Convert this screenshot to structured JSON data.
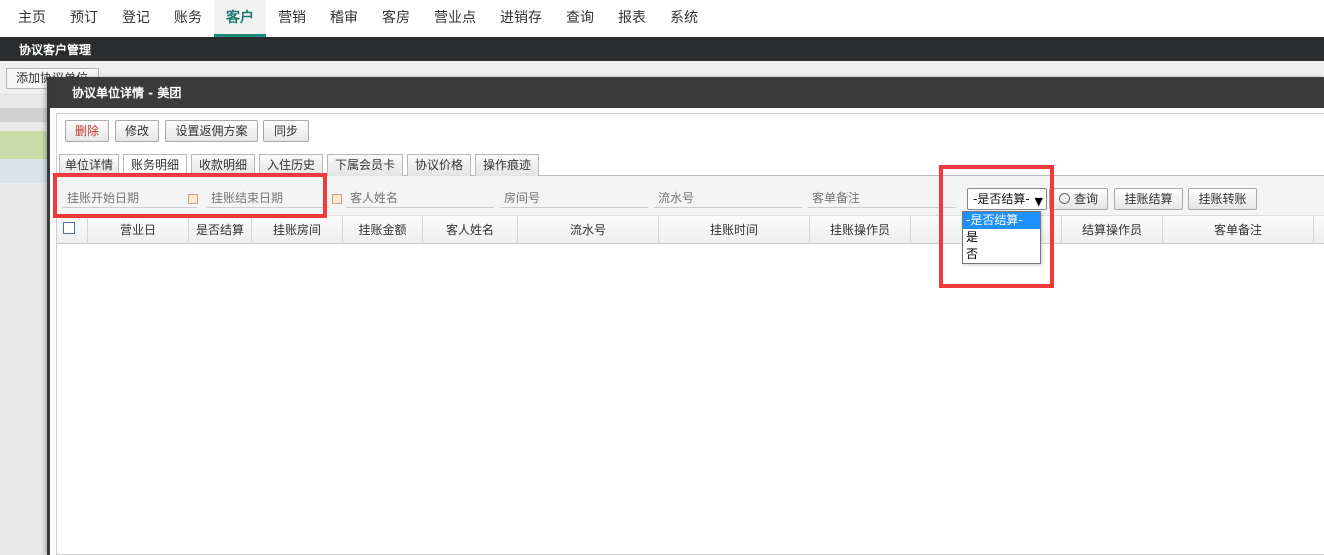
{
  "topnav": {
    "items": [
      "主页",
      "预订",
      "登记",
      "账务",
      "客户",
      "营销",
      "稽审",
      "客房",
      "营业点",
      "进销存",
      "查询",
      "报表",
      "系统"
    ],
    "active_index": 4
  },
  "page_title": "协议客户管理",
  "background": {
    "add_button": "添加协议单位"
  },
  "modal": {
    "title": "协议单位详情 - 美团",
    "buttons": {
      "delete": "删除",
      "edit": "修改",
      "rebate": "设置返佣方案",
      "sync": "同步"
    },
    "tabs": [
      "单位详情",
      "账务明细",
      "收款明细",
      "入住历史",
      "下属会员卡",
      "协议价格",
      "操作痕迹"
    ],
    "active_tab_index": 1,
    "filters": {
      "start_date_placeholder": "挂账开始日期",
      "end_date_placeholder": "挂账结束日期",
      "guest_name_placeholder": "客人姓名",
      "room_placeholder": "房间号",
      "serial_placeholder": "流水号",
      "remark_placeholder": "客单备注",
      "settle_select_value": "-是否结算-",
      "query_button": "查询",
      "settle_button": "挂账结算",
      "transfer_button": "挂账转账"
    },
    "dropdown_options": [
      "-是否结算-",
      "是",
      "否"
    ],
    "columns": [
      "营业日",
      "是否结算",
      "挂账房间",
      "挂账金额",
      "客人姓名",
      "流水号",
      "挂账时间",
      "挂账操作员",
      "结",
      "结算操作员",
      "客单备注"
    ]
  },
  "colors": {
    "accent": "#1e8a7a",
    "highlight": "#f23a3a",
    "dropdown_selected": "#1e90ff"
  }
}
